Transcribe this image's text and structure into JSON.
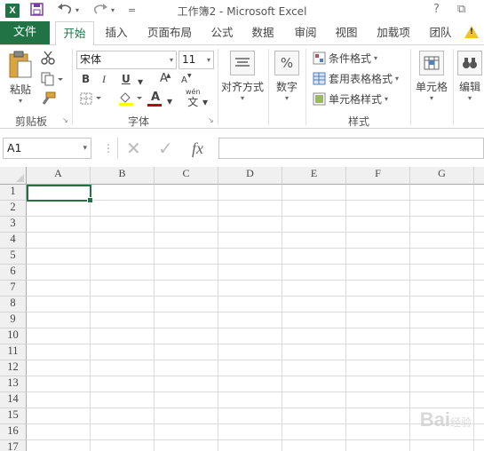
{
  "window": {
    "title": "工作簿2 - Microsoft Excel",
    "logo": "X",
    "help": "?",
    "restore": "⧉"
  },
  "quick_access": {
    "save_icon": "save-icon",
    "undo_icon": "undo-icon",
    "redo_icon": "redo-icon",
    "customize": "="
  },
  "tabs": {
    "file": "文件",
    "items": [
      "开始",
      "插入",
      "页面布局",
      "公式",
      "数据",
      "审阅",
      "视图",
      "加载项",
      "团队"
    ],
    "active": "开始"
  },
  "ribbon": {
    "clipboard": {
      "label": "剪贴板",
      "paste": "粘贴",
      "launcher": "↘"
    },
    "font": {
      "label": "字体",
      "name": "宋体",
      "size": "11",
      "bold": "B",
      "italic": "I",
      "underline": "U",
      "grow": "A",
      "shrink": "A",
      "font_color": "A",
      "phonetic_top": "wén",
      "phonetic_bottom": "文",
      "launcher": "↘"
    },
    "alignment": {
      "label": "对齐方式"
    },
    "number": {
      "label": "数字",
      "icon_text": "%"
    },
    "styles": {
      "label": "样式",
      "conditional": "条件格式",
      "table": "套用表格格式",
      "cell": "单元格样式"
    },
    "cells": {
      "label": "单元格"
    },
    "editing": {
      "label": "编辑"
    }
  },
  "formula_bar": {
    "name_box": "A1",
    "cancel": "✕",
    "enter": "✓",
    "fx": "fx",
    "value": ""
  },
  "grid": {
    "columns": [
      "A",
      "B",
      "C",
      "D",
      "E",
      "F",
      "G"
    ],
    "rows": [
      "1",
      "2",
      "3",
      "4",
      "5",
      "6",
      "7",
      "8",
      "9",
      "10",
      "11",
      "12",
      "13",
      "14",
      "15",
      "16",
      "17"
    ]
  },
  "watermark": {
    "text": "Bai",
    "suffix": "经验"
  }
}
